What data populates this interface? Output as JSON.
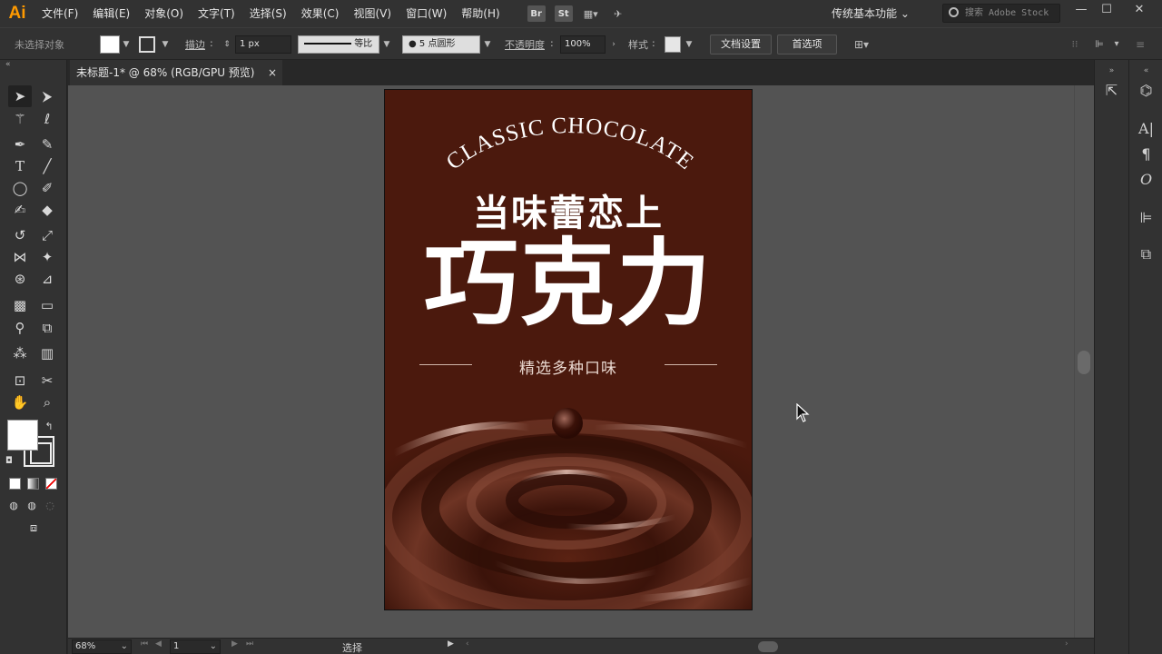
{
  "app": {
    "logo": "Ai"
  },
  "menu": [
    "文件(F)",
    "编辑(E)",
    "对象(O)",
    "文字(T)",
    "选择(S)",
    "效果(C)",
    "视图(V)",
    "窗口(W)",
    "帮助(H)"
  ],
  "menu_icons": {
    "bridge": "Br",
    "stock": "St"
  },
  "workspace": "传统基本功能",
  "stock_search_placeholder": "搜索 Adobe Stock",
  "window_controls": {
    "minimize": "—",
    "maximize": "☐",
    "close": "✕"
  },
  "control_bar": {
    "selection_label": "未选择对象",
    "stroke_label": "描边",
    "stroke_weight": "1 px",
    "profile_label": "等比",
    "brush_label": "5 点圆形",
    "opacity_label": "不透明度",
    "opacity_value": "100%",
    "style_label": "样式",
    "doc_setup_button": "文档设置",
    "preferences_button": "首选项"
  },
  "document_tab": {
    "title": "未标题-1* @ 68% (RGB/GPU 预览)",
    "close": "×"
  },
  "artwork": {
    "arc_text": "CLASSIC CHOCOLATE",
    "subtitle": "当味蕾恋上",
    "title": "巧克力",
    "tagline": "精选多种口味",
    "background_color": "#4b190d"
  },
  "status_bar": {
    "zoom": "68%",
    "page": "1",
    "status": "选择"
  }
}
